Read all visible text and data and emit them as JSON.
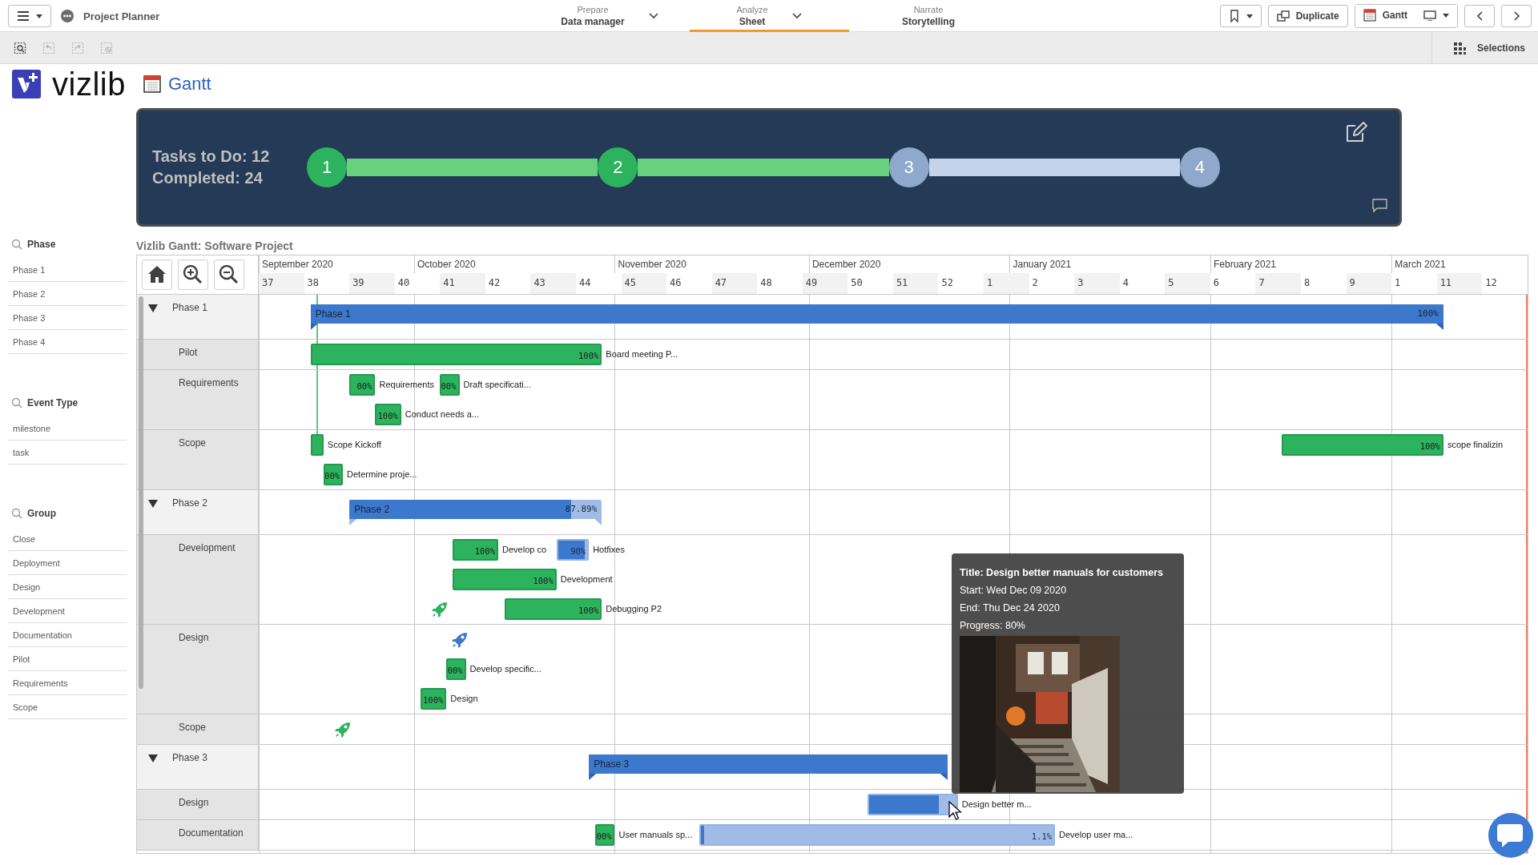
{
  "topbar": {
    "app_title": "Project Planner",
    "nav": [
      {
        "step": "Prepare",
        "label": "Data manager",
        "selected": false,
        "dropdown": true
      },
      {
        "step": "Analyze",
        "label": "Sheet",
        "selected": true,
        "dropdown": true
      },
      {
        "step": "Narrate",
        "label": "Storytelling",
        "selected": false,
        "dropdown": false
      }
    ],
    "actions": [
      {
        "kind": "bookmark"
      },
      {
        "kind": "duplicate",
        "label": "Duplicate"
      },
      {
        "kind": "sheet",
        "label": "Gantt"
      },
      {
        "kind": "prev"
      },
      {
        "kind": "next"
      }
    ]
  },
  "toolbar": {
    "tools": [
      {
        "kind": "smart-search",
        "disabled": false
      },
      {
        "kind": "step-back",
        "disabled": true
      },
      {
        "kind": "step-forward",
        "disabled": true
      },
      {
        "kind": "clear",
        "disabled": true
      }
    ],
    "selections": "Selections"
  },
  "brand": {
    "logo_text": "vizlib",
    "sheet_title": "Gantt"
  },
  "summary": {
    "lines": [
      "Tasks to Do: 12",
      "Completed: 24"
    ],
    "steps": [
      {
        "label": "1",
        "done": true
      },
      {
        "label": "2",
        "done": true
      },
      {
        "label": "3",
        "done": false
      },
      {
        "label": "4",
        "done": false
      }
    ]
  },
  "filters": [
    {
      "title": "Phase",
      "items": [
        "Phase 1",
        "Phase 2",
        "Phase 3",
        "Phase 4"
      ]
    },
    {
      "title": "Event Type",
      "items": [
        "milestone",
        "task"
      ]
    },
    {
      "title": "Group",
      "items": [
        "Close",
        "Deployment",
        "Design",
        "Development",
        "Documentation",
        "Pilot",
        "Requirements",
        "Scope"
      ]
    }
  ],
  "gantt": {
    "title": "Vizlib Gantt: Software Project",
    "months": [
      "September 2020",
      "October 2020",
      "November 2020",
      "December 2020",
      "January 2021",
      "February 2021",
      "March 2021"
    ],
    "weeks": [
      "37",
      "38",
      "39",
      "40",
      "41",
      "42",
      "43",
      "44",
      "45",
      "46",
      "47",
      "48",
      "49",
      "50",
      "51",
      "52",
      "1",
      "2",
      "3",
      "4",
      "5",
      "6",
      "7",
      "8",
      "9",
      "1",
      "11",
      "12"
    ],
    "groups": [
      {
        "label": "Phase 1",
        "expanded": true,
        "summary": {
          "label": "Phase 1",
          "level": 1,
          "percent": "100%"
        },
        "children": [
          {
            "label": "Pilot",
            "lanes": [
              [
                {
                  "kind": "bar",
                  "level": 1,
                  "percent": "100%",
                  "label": "Board meeting P..."
                }
              ]
            ]
          },
          {
            "label": "Requirements",
            "lanes": [
              [
                {
                  "kind": "bar",
                  "level": 1,
                  "percent": "00%",
                  "label": "Requirements"
                },
                {
                  "kind": "bar",
                  "level": 1,
                  "percent": "00%",
                  "label": "Draft specificati..."
                }
              ],
              [
                {
                  "kind": "bar",
                  "level": 1,
                  "percent": "100%",
                  "label": "Conduct needs a..."
                }
              ]
            ]
          },
          {
            "label": "Scope",
            "lanes": [
              [
                {
                  "kind": "bar",
                  "level": 1,
                  "label": "Scope Kickoff",
                  "pinned": true
                },
                {
                  "kind": "bar",
                  "level": 1,
                  "percent": "100%",
                  "label": "scope finalizin"
                }
              ],
              [
                {
                  "kind": "bar",
                  "level": 1,
                  "percent": "00%",
                  "label": "Determine proje..."
                }
              ]
            ]
          }
        ]
      },
      {
        "label": "Phase 2",
        "expanded": true,
        "summary": {
          "label": "Phase 2",
          "level": 0.8789,
          "percent": "87.89%"
        },
        "children": [
          {
            "label": "Development",
            "lanes": [
              [
                {
                  "kind": "bar",
                  "level": 1,
                  "percent": "100%",
                  "label": "Develop co"
                },
                {
                  "kind": "bar",
                  "level": 0.9,
                  "percent": "90%",
                  "label": "Hotfixes"
                }
              ],
              [
                {
                  "kind": "bar",
                  "level": 1,
                  "percent": "100%",
                  "label": "Development"
                }
              ],
              [
                {
                  "kind": "milestone",
                  "color": "#2db35d"
                },
                {
                  "kind": "bar",
                  "level": 1,
                  "percent": "100%",
                  "label": "Debugging P2"
                }
              ]
            ]
          },
          {
            "label": "Design",
            "lanes": [
              [
                {
                  "kind": "milestone",
                  "color": "#3c78cc"
                }
              ],
              [
                {
                  "kind": "bar",
                  "level": 1,
                  "percent": "00%",
                  "label": "Develop specific..."
                }
              ],
              [
                {
                  "kind": "bar",
                  "level": 1,
                  "percent": "100%",
                  "label": "Design"
                }
              ]
            ]
          },
          {
            "label": "Scope",
            "lanes": [
              [
                {
                  "kind": "milestone",
                  "color": "#2db35d"
                }
              ]
            ]
          }
        ]
      },
      {
        "label": "Phase 3",
        "expanded": true,
        "summary": {
          "label": "Phase 3",
          "level": 1
        },
        "children": [
          {
            "label": "Design",
            "lanes": [
              [
                {
                  "kind": "bar",
                  "level": 0.8,
                  "label": "Design better m..."
                }
              ]
            ]
          },
          {
            "label": "Documentation",
            "lanes": [
              [
                {
                  "kind": "bar",
                  "level": 1,
                  "percent": "00%",
                  "label": "User manuals sp..."
                },
                {
                  "kind": "bar",
                  "level": 0.011,
                  "percent": "1.1%",
                  "label": "Develop user ma..."
                }
              ]
            ]
          }
        ]
      }
    ],
    "tooltip": {
      "title": "Title: Design better manuals for customers",
      "lines": [
        "Start: Wed Dec 09 2020",
        "End: Thu Dec 24 2020",
        "Progress: 80%"
      ]
    }
  }
}
